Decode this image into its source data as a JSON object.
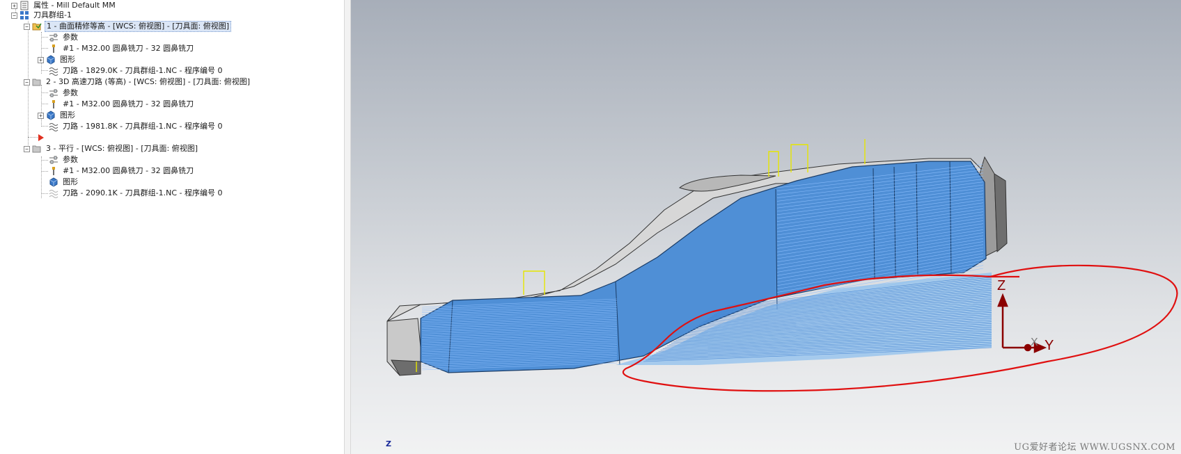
{
  "tree": {
    "properties": {
      "label": "属性",
      "value": " - Mill Default MM"
    },
    "group": "刀具群组-1",
    "operations": [
      {
        "title": "1 - 曲面精修等高 - [WCS: 俯视图] - [刀具面: 俯视图]",
        "params": "参数",
        "tool": "#1 - M32.00 圆鼻铣刀 - 32 圆鼻铣刀",
        "geometry": "图形",
        "toolpath": "刀路 - 1829.0K - 刀具群组-1.NC - 程序编号 0"
      },
      {
        "title": "2 - 3D 高速刀路 (等高) - [WCS: 俯视图] - [刀具面: 俯视图]",
        "params": "参数",
        "tool": "#1 - M32.00 圆鼻铣刀 - 32 圆鼻铣刀",
        "geometry": "图形",
        "toolpath": "刀路 - 1981.8K - 刀具群组-1.NC - 程序编号 0"
      },
      {
        "title": "3 - 平行 - [WCS: 俯视图] - [刀具面: 俯视图]",
        "params": "参数",
        "tool": "#1 - M32.00 圆鼻铣刀 - 32 圆鼻铣刀",
        "geometry": "图形",
        "toolpath": "刀路 - 2090.1K - 刀具群组-1.NC - 程序编号 0"
      }
    ]
  },
  "viewport": {
    "axis_z": "Z",
    "axis_y": "Y",
    "axis_x": "X",
    "view_indicator": "Z",
    "watermark": "UG爱好者论坛 WWW.UGSNX.COM"
  },
  "colors": {
    "toolpath_blue": "#3d7fd1",
    "part_gray": "#9a9a9a",
    "annotation_red": "#e01010",
    "axis_dark_red": "#8b0000",
    "tool_yellow": "#e6e600"
  }
}
